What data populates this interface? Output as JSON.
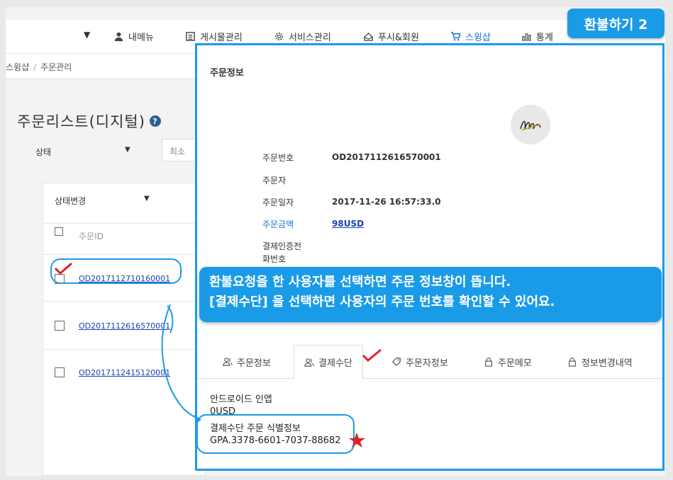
{
  "header": {
    "dropdown_arrow": "▼",
    "menu": [
      {
        "label": "내메뉴",
        "icon": "user-icon"
      },
      {
        "label": "게시물관리",
        "icon": "list-icon"
      },
      {
        "label": "서비스관리",
        "icon": "gear-icon"
      },
      {
        "label": "푸시&회원",
        "icon": "megaphone-icon"
      },
      {
        "label": "스윙샵",
        "icon": "cart-icon",
        "active": true
      },
      {
        "label": "통계",
        "icon": "bar-chart-icon"
      }
    ]
  },
  "breadcrumb": {
    "items": [
      "스윙샵",
      "주문관리"
    ],
    "separator": "/"
  },
  "list": {
    "title": "주문리스트(디지털)",
    "help_glyph": "?",
    "status_filter": "상태",
    "search_placeholder": "최소",
    "status_change": "상태변경",
    "column_header": "주문ID",
    "orders": [
      {
        "id": "OD2017112710160001",
        "checked": true
      },
      {
        "id": "OD2017112616570001",
        "checked": false
      },
      {
        "id": "OD2017112415120001",
        "checked": false
      }
    ]
  },
  "detail": {
    "title": "주문정보",
    "fields": [
      {
        "label": "주문번호",
        "value": "OD2017112616570001"
      },
      {
        "label": "주문자",
        "value": ""
      },
      {
        "label": "주문일자",
        "value": "2017-11-26 16:57:33.0"
      },
      {
        "label": "주문금액",
        "value": "98USD",
        "highlight": true
      },
      {
        "label": "결제인증전\n화번호",
        "value": ""
      }
    ],
    "tabs": [
      {
        "label": "주문정보",
        "icon": "users-icon"
      },
      {
        "label": "결제수단",
        "icon": "users-icon",
        "active": true
      },
      {
        "label": "주문자정보",
        "icon": "tag-icon"
      },
      {
        "label": "주문메모",
        "icon": "lock-icon"
      },
      {
        "label": "정보변경내역",
        "icon": "lock-icon"
      }
    ],
    "payment": {
      "method": "안드로이드 인앱",
      "amount": "0USD",
      "id_label": "결제수단 주문 식별정보",
      "id_value": "GPA.3378-6601-7037-88682"
    }
  },
  "overlay": {
    "badge": "환불하기 2",
    "callout_line1": "환불요청을 한 사용자를 선택하면 주문 정보창이 뜹니다.",
    "callout_line2": "[결제수단] 을 선택하면 사용자의 주문 번호를 확인할 수 있어요."
  },
  "colors": {
    "accent": "#1a9be8",
    "link": "#1a3fb5",
    "nav_active": "#1e6fd9",
    "mark": "#e0222a"
  }
}
